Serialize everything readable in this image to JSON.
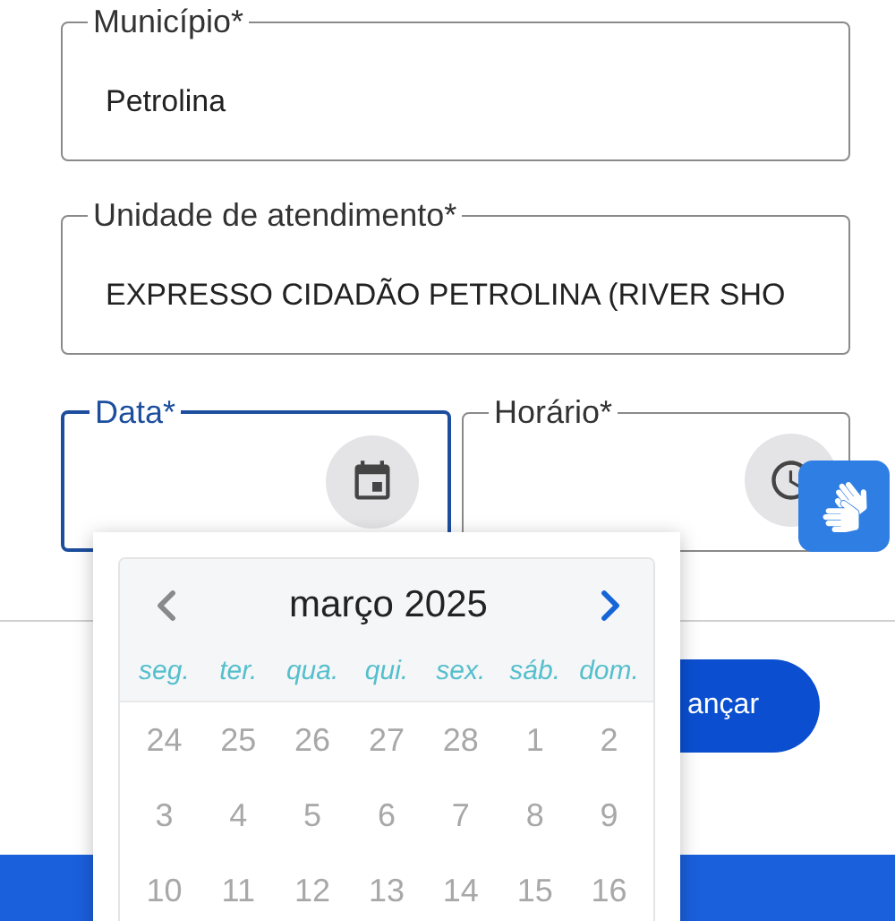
{
  "fields": [
    {
      "label": "Município*",
      "value": "Petrolina"
    },
    {
      "label": "Unidade de atendimento*",
      "value": "EXPRESSO CIDADÃO PETROLINA (RIVER SHO"
    }
  ],
  "date_field": {
    "label": "Data*",
    "focused": true
  },
  "time_field": {
    "label": "Horário*",
    "focused": false
  },
  "next_button": {
    "label": "ançar"
  },
  "calendar": {
    "month": "março 2025",
    "prev_disabled": true,
    "next_disabled": false,
    "weekdays": [
      "seg.",
      "ter.",
      "qua.",
      "qui.",
      "sex.",
      "sáb.",
      "dom."
    ],
    "weeks": [
      [
        {
          "label": "24",
          "disabled": true
        },
        {
          "label": "25",
          "disabled": true
        },
        {
          "label": "26",
          "disabled": true
        },
        {
          "label": "27",
          "disabled": true
        },
        {
          "label": "28",
          "disabled": true
        },
        {
          "label": "1",
          "disabled": true
        },
        {
          "label": "2",
          "disabled": true
        }
      ],
      [
        {
          "label": "3",
          "disabled": true
        },
        {
          "label": "4",
          "disabled": true
        },
        {
          "label": "5",
          "disabled": true
        },
        {
          "label": "6",
          "disabled": true
        },
        {
          "label": "7",
          "disabled": true
        },
        {
          "label": "8",
          "disabled": true
        },
        {
          "label": "9",
          "disabled": true
        }
      ],
      [
        {
          "label": "10",
          "disabled": true
        },
        {
          "label": "11",
          "disabled": true
        },
        {
          "label": "12",
          "disabled": true
        },
        {
          "label": "13",
          "disabled": true
        },
        {
          "label": "14",
          "disabled": true
        },
        {
          "label": "15",
          "disabled": true
        },
        {
          "label": "16",
          "disabled": true
        }
      ]
    ]
  }
}
